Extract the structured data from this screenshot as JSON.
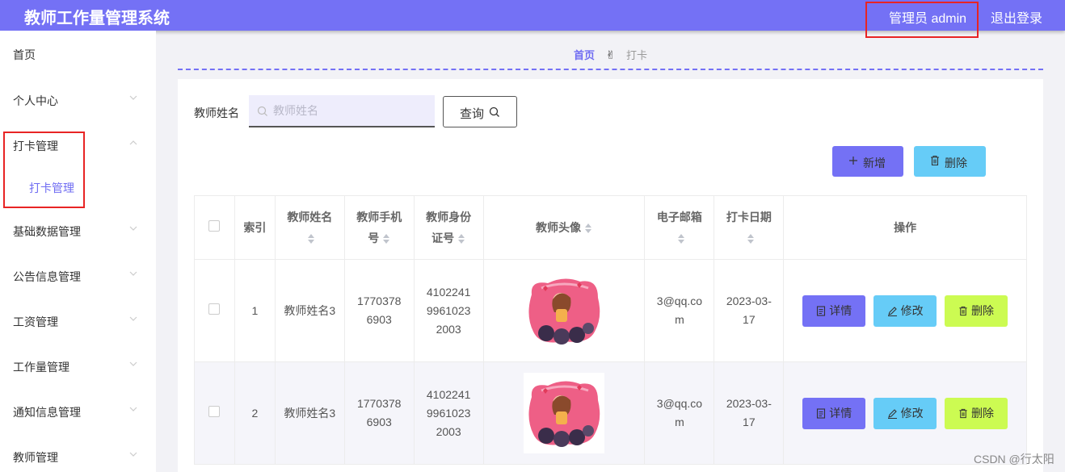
{
  "header": {
    "title": "教师工作量管理系统",
    "admin": "管理员 admin",
    "logout": "退出登录"
  },
  "sidebar": {
    "items": [
      {
        "label": "首页"
      },
      {
        "label": "个人中心"
      },
      {
        "label": "打卡管理"
      },
      {
        "label": "基础数据管理"
      },
      {
        "label": "公告信息管理"
      },
      {
        "label": "工资管理"
      },
      {
        "label": "工作量管理"
      },
      {
        "label": "通知信息管理"
      },
      {
        "label": "教师管理"
      }
    ],
    "subitem": "打卡管理"
  },
  "breadcrumb": {
    "home": "首页",
    "separator": "✌",
    "current": "打卡"
  },
  "search": {
    "label": "教师姓名",
    "placeholder": "教师姓名",
    "button": "查询"
  },
  "actions": {
    "add": "新增",
    "delete": "删除"
  },
  "table": {
    "headers": {
      "index": "索引",
      "name": "教师姓名",
      "phone_1": "教师手机",
      "phone_2": "号",
      "idcard_1": "教师身份",
      "idcard_2": "证号",
      "avatar": "教师头像",
      "email": "电子邮箱",
      "date": "打卡日期",
      "ops": "操作"
    },
    "rows": [
      {
        "index": "1",
        "name": "教师姓名3",
        "phone_1": "1770378",
        "phone_2": "6903",
        "id_1": "4102241",
        "id_2": "9961023",
        "id_3": "2003",
        "email_1": "3@qq.co",
        "email_2": "m",
        "date_1": "2023-03-",
        "date_2": "17"
      },
      {
        "index": "2",
        "name": "教师姓名3",
        "phone_1": "1770378",
        "phone_2": "6903",
        "id_1": "4102241",
        "id_2": "9961023",
        "id_3": "2003",
        "email_1": "3@qq.co",
        "email_2": "m",
        "date_1": "2023-03-",
        "date_2": "17"
      }
    ],
    "ops": {
      "detail": "详情",
      "edit": "修改",
      "delete": "删除"
    }
  },
  "watermark": "CSDN @行太阳",
  "colors": {
    "primary": "#7471f5",
    "info": "#66ccf7",
    "danger_btn": "#ccfb52",
    "highlight": "#e82424"
  }
}
